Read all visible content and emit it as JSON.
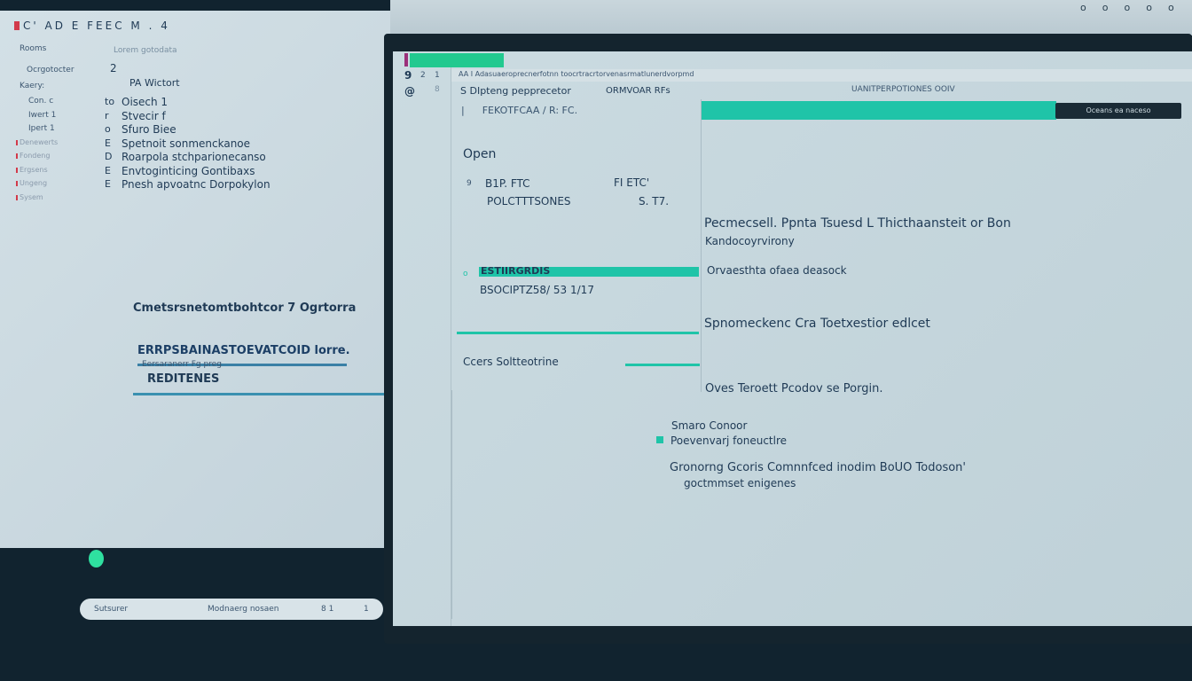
{
  "left_screen": {
    "toolbar": "C'  AD  E  FEEC  M  .  4",
    "subtitle_left": "Rooms",
    "subtitle_right": "Lorem gotodata",
    "label1": "Ocrgotocter",
    "label1_value": "2",
    "label2": "Kaery:",
    "label2_value": "PA Wictort",
    "rows": [
      {
        "label": "Con. c",
        "mark": "to",
        "text": "Oisech 1"
      },
      {
        "label": "Iwert 1",
        "mark": "r",
        "text": "Stvecir f"
      },
      {
        "label": "Ipert 1",
        "mark": "o",
        "text": "Sfuro Biee"
      },
      {
        "label": "Denewerts",
        "mark": "E",
        "text": "Spetnoit sonmenckanoe"
      },
      {
        "label": "Fondeng",
        "mark": "D",
        "text": "Roarpola stchparionecanso"
      },
      {
        "label": "Ergsens",
        "mark": "E",
        "text": "Envtoginticing Gontibaxs"
      },
      {
        "label": "Ungeng",
        "mark": "E",
        "text": "Pnesh apvoatnc Dorpokylon"
      },
      {
        "label": "Sysem",
        "mark": "",
        "text": ""
      }
    ],
    "heading": "Cmetsrsnetomtbohtcor 7 Ogrtorra",
    "link1": "ERRPSBAINASTOEVATCOID lorre.",
    "link1_sub": "Eersaranerr  Fg preg",
    "link2": "REDITENES",
    "bottom_bar": {
      "left": "Sutsurer",
      "right": "Modnaerg nosaen",
      "count": "8 1",
      "icon": "1"
    },
    "status_color": "#2fe0a0"
  },
  "top_icons": [
    "o",
    "o",
    "o",
    "o",
    "o"
  ],
  "right_screen": {
    "icons_col": [
      "9",
      "2",
      "1",
      "@",
      "8"
    ],
    "address": "AA  I  Adasuaeroprecnerfotnn toocrtracrtorvenasrmatlunerdvorpmd",
    "header_left": "S DIpteng pepprecetor",
    "header_mid": "ORMVOAR RFs",
    "header_right": "UANITPERPOTIONES OOIV",
    "breadcrumb": "FEKOTFCAA  /  R:  FC.",
    "button": "Oceans ea naceso",
    "open": "Open",
    "item1": {
      "a": "B1P.  FTC",
      "b": "FI  ETC'",
      "c": "POLCTTTSONES",
      "d": "S. T7."
    },
    "item2": {
      "a": "ESTIIRGRDIS",
      "b": "BSOCIPTZ58/ 53  1/17"
    },
    "item3": "Ccers Soltteotrine",
    "main": [
      "Pecmecsell. Ppnta Tsuesd  L  Thicthaansteit or Bon",
      "Kandocoyrvirony",
      "Orvaesthta ofaea  deasock",
      "Spnomeckenc Cra  Toetxestior edlcet",
      "Oves Teroett  Pcodov se Porgin.",
      "Smaro Conoor",
      "Poevenvarj foneuctlre",
      "Gronorng Gcoris  Comnnfced  inodim BoUO  Todoson'",
      "goctmmset enigenes"
    ],
    "accent": "#1fc4a8",
    "tab_color": "#22c98f"
  }
}
